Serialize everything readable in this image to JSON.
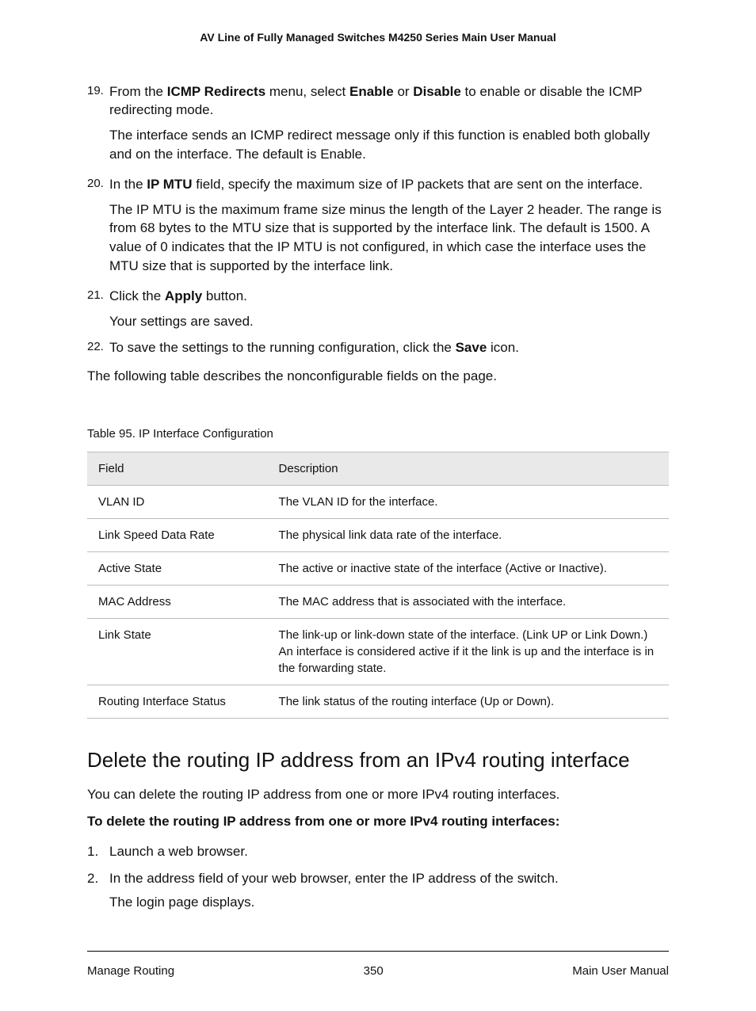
{
  "header": {
    "title": "AV Line of Fully Managed Switches M4250 Series Main User Manual"
  },
  "steps": [
    {
      "num": "19.",
      "main_pre": "From the ",
      "main_b1": "ICMP Redirects",
      "main_mid1": " menu, select ",
      "main_b2": "Enable",
      "main_mid2": " or ",
      "main_b3": "Disable",
      "main_post": " to enable or disable the ICMP redirecting mode.",
      "sub": "The interface sends an ICMP redirect message only if this function is enabled both globally and on the interface. The default is Enable."
    },
    {
      "num": "20.",
      "main_pre": "In the ",
      "main_b1": "IP MTU",
      "main_post": " field, specify the maximum size of IP packets that are sent on the interface.",
      "sub": "The IP MTU is the maximum frame size minus the length of the Layer 2 header. The range is from 68 bytes to the MTU size that is supported by the interface link. The default is 1500. A value of 0 indicates that the IP MTU is not configured, in which case the interface uses the MTU size that is supported by the interface link."
    },
    {
      "num": "21.",
      "main_pre": "Click the ",
      "main_b1": "Apply",
      "main_post": " button.",
      "sub": "Your settings are saved."
    },
    {
      "num": "22.",
      "main_pre": "To save the settings to the running configuration, click the ",
      "main_b1": "Save",
      "main_post": " icon."
    }
  ],
  "para_after": "The following table describes the nonconfigurable fields on the page.",
  "table": {
    "caption": "Table 95. IP Interface Configuration",
    "headers": {
      "field": "Field",
      "desc": "Description"
    },
    "rows": [
      {
        "field": "VLAN ID",
        "desc": "The VLAN ID for the interface."
      },
      {
        "field": "Link Speed Data Rate",
        "desc": "The physical link data rate of the interface."
      },
      {
        "field": "Active State",
        "desc": "The active or inactive state of the interface (Active or Inactive)."
      },
      {
        "field": "MAC Address",
        "desc": "The MAC address that is associated with the interface."
      },
      {
        "field": "Link State",
        "desc": "The link-up or link-down state of the interface. (Link UP or Link Down.) An interface is considered active if it the link is up and the interface is in the forwarding state."
      },
      {
        "field": "Routing Interface Status",
        "desc": "The link status of the routing interface (Up or Down)."
      }
    ]
  },
  "section": {
    "heading": "Delete the routing IP address from an IPv4 routing interface",
    "intro": "You can delete the routing IP address from one or more IPv4 routing interfaces.",
    "subhead": "To delete the routing IP address from one or more IPv4 routing interfaces:",
    "steps": [
      {
        "num": "1.",
        "text": "Launch a web browser."
      },
      {
        "num": "2.",
        "text": "In the address field of your web browser, enter the IP address of the switch.",
        "sub": "The login page displays."
      }
    ]
  },
  "footer": {
    "left": "Manage Routing",
    "center": "350",
    "right": "Main User Manual"
  }
}
